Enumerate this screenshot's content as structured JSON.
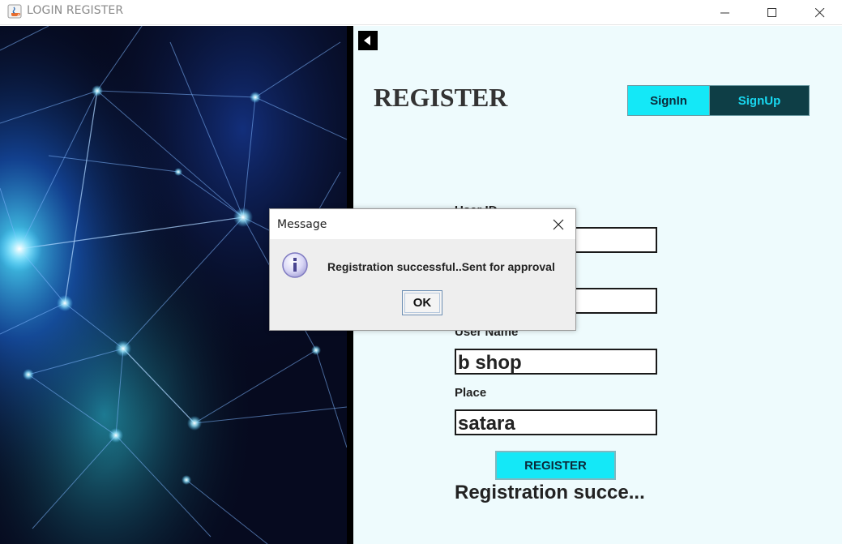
{
  "window": {
    "title": "LOGIN REGISTER"
  },
  "form": {
    "heading": "REGISTER",
    "tabs": [
      {
        "label": "SignIn",
        "active": false
      },
      {
        "label": "SignUp",
        "active": true
      }
    ],
    "fields": {
      "user_id": {
        "label": "User ID",
        "value": ""
      },
      "password": {
        "label": "",
        "value": ""
      },
      "user_name": {
        "label": "User Name",
        "value": "b shop"
      },
      "place": {
        "label": "Place",
        "value": "satara"
      }
    },
    "register_label": "REGISTER",
    "status_text": "Registration succe..."
  },
  "dialog": {
    "title": "Message",
    "message": "Registration successful..Sent for approval",
    "ok_label": "OK"
  },
  "colors": {
    "accent_cyan": "#14e8f7",
    "dark_teal": "#0e3e46",
    "panel_bg": "#eefbfd"
  }
}
